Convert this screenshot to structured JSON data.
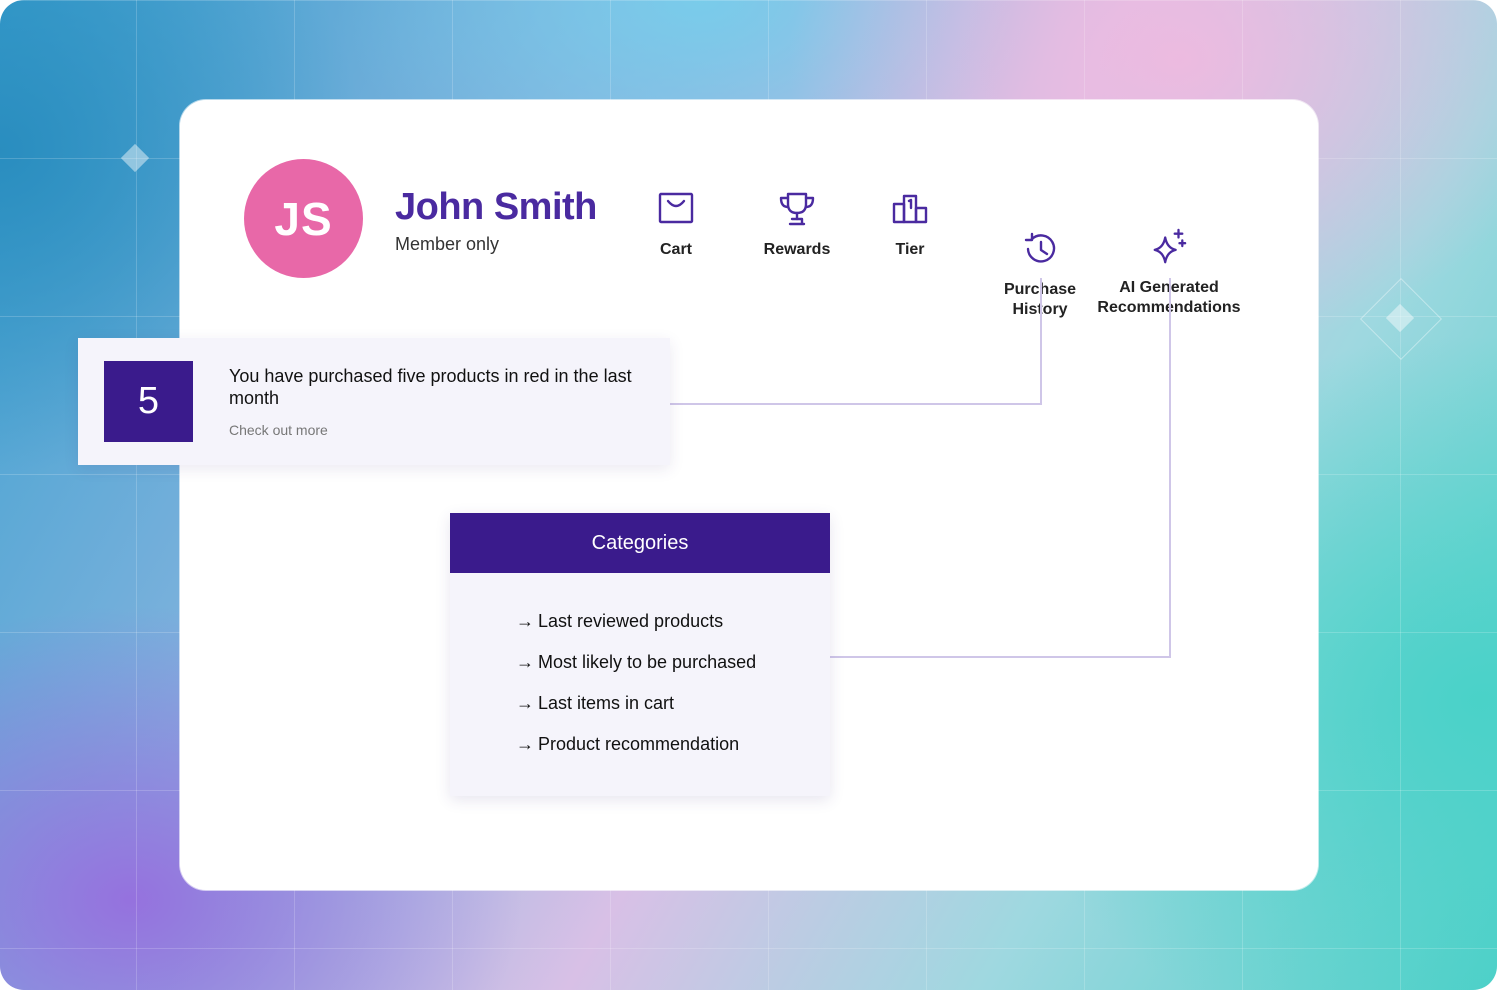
{
  "user": {
    "initials": "JS",
    "name": "John Smith",
    "role": "Member only"
  },
  "nav": [
    {
      "label": "Cart",
      "icon": "shopping-bag-icon"
    },
    {
      "label": "Rewards",
      "icon": "trophy-icon"
    },
    {
      "label": "Tier",
      "icon": "podium-icon"
    },
    {
      "label": "Purchase\nHistory",
      "icon": "history-icon"
    },
    {
      "label": "AI Generated\nRecommendations",
      "icon": "sparkles-icon"
    }
  ],
  "notification": {
    "count": "5",
    "message": "You have purchased five products in red in the last month",
    "link": "Check out more"
  },
  "categories": {
    "title": "Categories",
    "items": [
      "Last reviewed products",
      "Most likely to be purchased",
      "Last items in cart",
      "Product recommendation"
    ]
  },
  "colors": {
    "brand": "#4a2aa0",
    "accent_dark": "#3a1b8c",
    "avatar": "#e868a8",
    "connector": "#cfc6e8"
  }
}
